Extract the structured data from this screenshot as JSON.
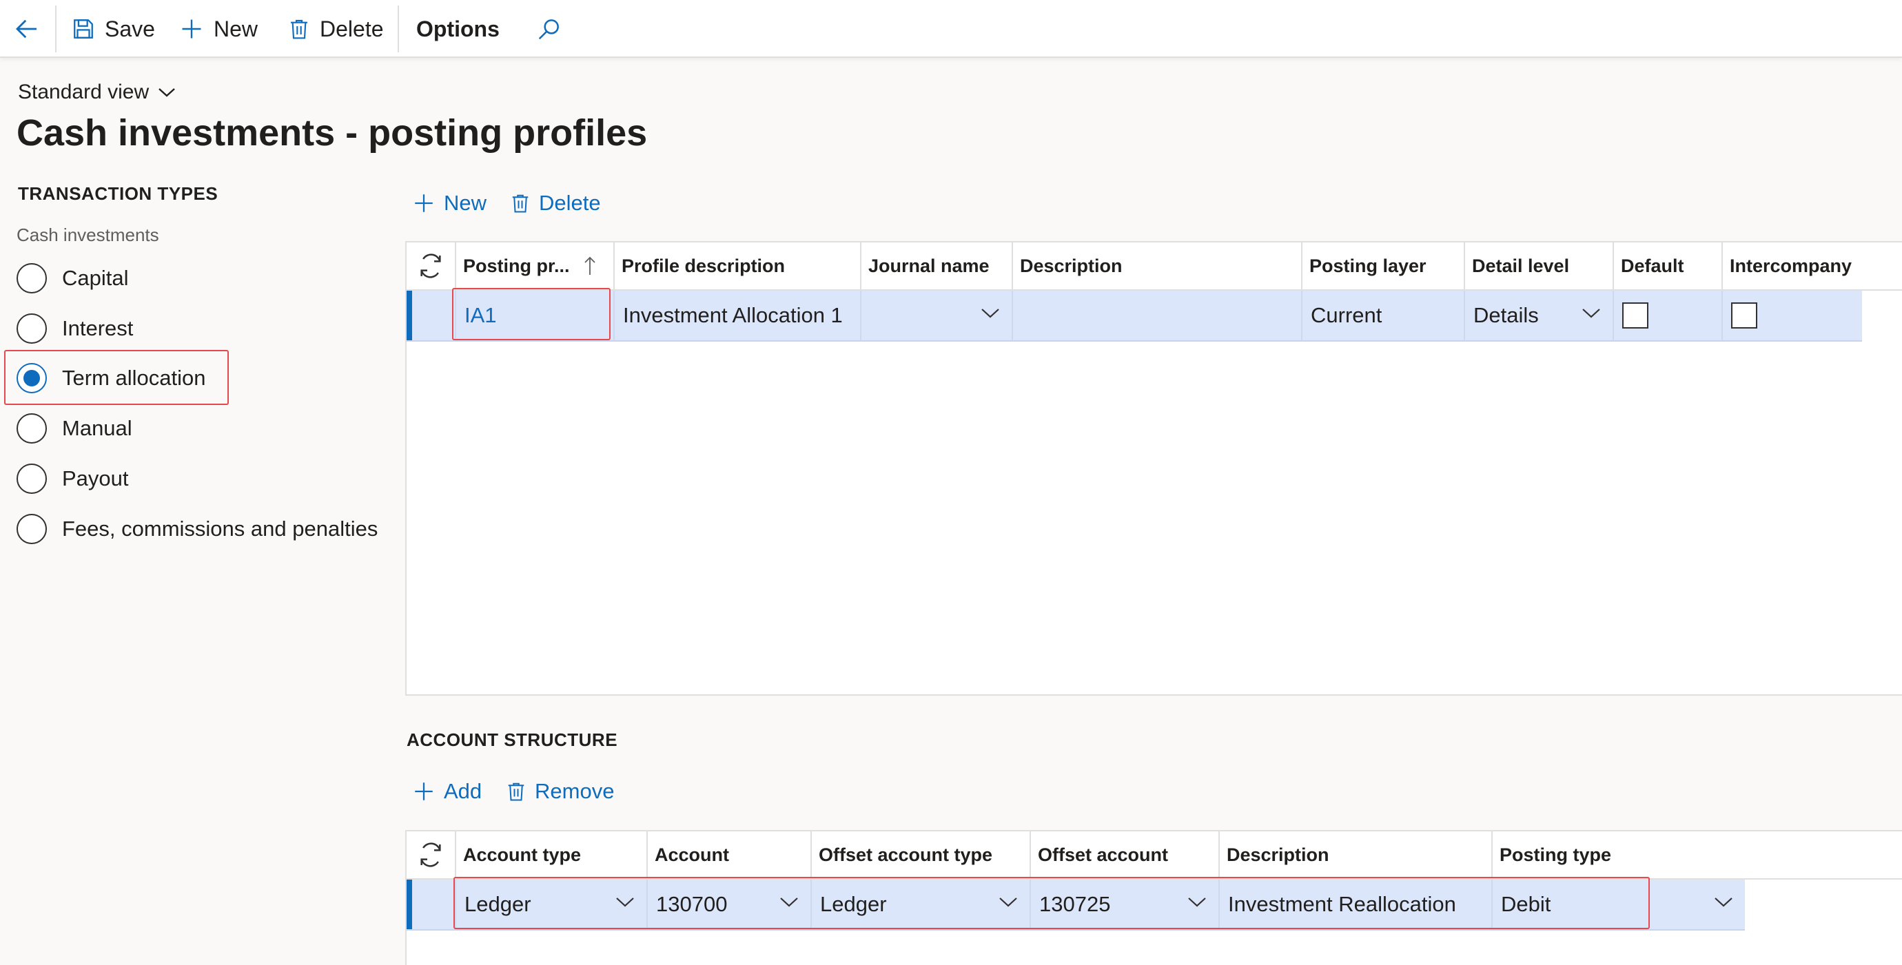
{
  "toolbar": {
    "back_label": "",
    "save_label": "Save",
    "new_label": "New",
    "delete_label": "Delete",
    "options_label": "Options"
  },
  "header": {
    "view_label": "Standard view",
    "title": "Cash investments - posting profiles"
  },
  "transaction_types": {
    "heading": "TRANSACTION TYPES",
    "group_label": "Cash investments",
    "options": [
      {
        "label": "Capital",
        "selected": false
      },
      {
        "label": "Interest",
        "selected": false
      },
      {
        "label": "Term allocation",
        "selected": true
      },
      {
        "label": "Manual",
        "selected": false
      },
      {
        "label": "Payout",
        "selected": false
      },
      {
        "label": "Fees, commissions and penalties",
        "selected": false
      }
    ]
  },
  "profiles_actions": {
    "new_label": "New",
    "delete_label": "Delete"
  },
  "profiles_grid": {
    "columns": [
      "Posting pr...",
      "Profile description",
      "Journal name",
      "Description",
      "Posting layer",
      "Detail level",
      "Default",
      "Intercompany"
    ],
    "rows": [
      {
        "posting_profile": "IA1",
        "profile_description": "Investment Allocation 1",
        "journal_name": "",
        "description": "",
        "posting_layer": "Current",
        "detail_level": "Details",
        "default": false,
        "intercompany": false
      }
    ]
  },
  "account_structure": {
    "heading": "ACCOUNT STRUCTURE",
    "add_label": "Add",
    "remove_label": "Remove",
    "columns": [
      "Account type",
      "Account",
      "Offset account type",
      "Offset account",
      "Description",
      "Posting type"
    ],
    "rows": [
      {
        "account_type": "Ledger",
        "account": "130700",
        "offset_account_type": "Ledger",
        "offset_account": "130725",
        "description": "Investment Reallocation",
        "posting_type": "Debit"
      }
    ]
  },
  "colors": {
    "accent": "#0f6cbd",
    "selected_row": "#dce6fa",
    "highlight_box": "#e5484d"
  }
}
